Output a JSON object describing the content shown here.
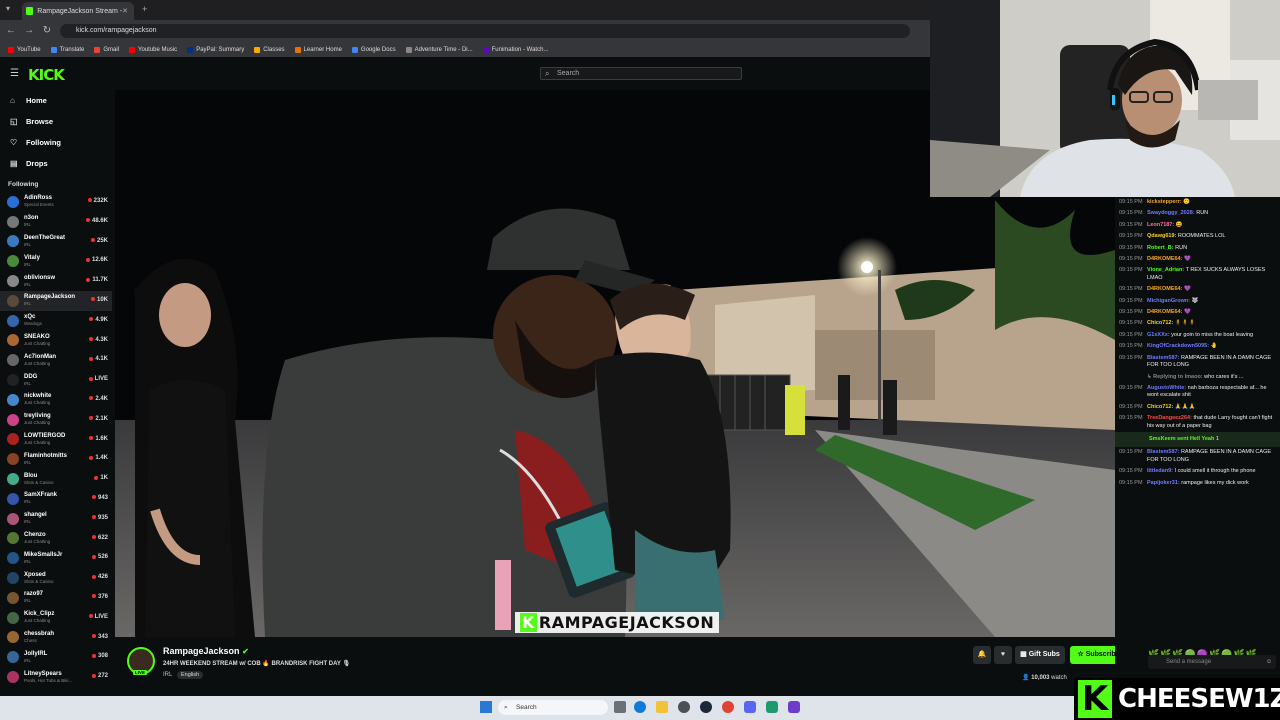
{
  "browser": {
    "tab_title": "RampageJackson Stream - ",
    "url": "kick.com/rampagejackson",
    "bookmarks": [
      {
        "label": "YouTube",
        "color": "#ff0000"
      },
      {
        "label": "Translate",
        "color": "#4285f4"
      },
      {
        "label": "Gmail",
        "color": "#ea4335"
      },
      {
        "label": "Youtube Music",
        "color": "#ff0000"
      },
      {
        "label": "PayPal: Summary",
        "color": "#003087"
      },
      {
        "label": "Classes",
        "color": "#f9ab00"
      },
      {
        "label": "Learner Home",
        "color": "#e8710a"
      },
      {
        "label": "Google Docs",
        "color": "#4285f4"
      },
      {
        "label": "Adventure Time - Di...",
        "color": "#888888"
      },
      {
        "label": "Funimation - Watch...",
        "color": "#5b0bb5"
      }
    ]
  },
  "header": {
    "logo": "KICK",
    "search_placeholder": "Search"
  },
  "nav": [
    {
      "label": "Home",
      "icon": "⌂"
    },
    {
      "label": "Browse",
      "icon": "◱"
    },
    {
      "label": "Following",
      "icon": "♡"
    },
    {
      "label": "Drops",
      "icon": "▤"
    }
  ],
  "following": {
    "heading": "Following",
    "items": [
      {
        "name": "AdinRoss",
        "cat": "Special Events",
        "count": "232K"
      },
      {
        "name": "n3on",
        "cat": "IRL",
        "count": "48.6K"
      },
      {
        "name": "DeenTheGreat",
        "cat": "IRL",
        "count": "25K"
      },
      {
        "name": "Vitaly",
        "cat": "IRL",
        "count": "12.6K"
      },
      {
        "name": "oblivionsw",
        "cat": "IRL",
        "count": "11.7K"
      },
      {
        "name": "RampageJackson",
        "cat": "IRL",
        "count": "10K",
        "active": true
      },
      {
        "name": "xQc",
        "cat": "Wardogs",
        "count": "4.9K"
      },
      {
        "name": "SNEAKO",
        "cat": "Just Chatting",
        "count": "4.3K"
      },
      {
        "name": "Ac7ionMan",
        "cat": "Just Chatting",
        "count": "4.1K"
      },
      {
        "name": "DDG",
        "cat": "IRL",
        "count": "LIVE"
      },
      {
        "name": "nickwhite",
        "cat": "Just Chatting",
        "count": "2.4K"
      },
      {
        "name": "treyliving",
        "cat": "Just Chatting",
        "count": "2.1K"
      },
      {
        "name": "LOWTIERGOD",
        "cat": "Just Chatting",
        "count": "1.6K"
      },
      {
        "name": "Flaminhotmitts",
        "cat": "IRL",
        "count": "1.4K"
      },
      {
        "name": "Blou",
        "cat": "Slots & Casino",
        "count": "1K"
      },
      {
        "name": "SamXFrank",
        "cat": "IRL",
        "count": "943"
      },
      {
        "name": "shangel",
        "cat": "IRL",
        "count": "935"
      },
      {
        "name": "Chenzo",
        "cat": "Just Chatting",
        "count": "622"
      },
      {
        "name": "MikeSmallsJr",
        "cat": "IRL",
        "count": "526"
      },
      {
        "name": "Xposed",
        "cat": "Slots & Casino",
        "count": "426"
      },
      {
        "name": "razo97",
        "cat": "IRL",
        "count": "376"
      },
      {
        "name": "Kick_Clipz",
        "cat": "Just Chatting",
        "count": "LIVE"
      },
      {
        "name": "chessbrah",
        "cat": "Chess",
        "count": "343"
      },
      {
        "name": "JollyIRL",
        "cat": "IRL",
        "count": "308"
      },
      {
        "name": "LitneySpears",
        "cat": "Pools, Hot Tubs & Biki...",
        "count": "272"
      }
    ]
  },
  "stream": {
    "streamer": "RampageJackson",
    "title": "24HR WEEKEND STREAM w/ COB 🔥 BRANDRISK FIGHT DAY 🎙",
    "category": "IRL",
    "language": "English",
    "viewers": "10,003",
    "watch_suffix": "watch",
    "overlay_text": "RAMPAGEJACKSON",
    "live_badge": "LIVE"
  },
  "actions": {
    "gift": "Gift Subs",
    "subscribe": "Subscribe",
    "chat_placeholder": "Send a message"
  },
  "chat": [
    {
      "t": "09:15 PM",
      "u": "kickstepperr:",
      "c": "#f5a623",
      "m": "",
      "e": "🙂"
    },
    {
      "t": "09:15 PM",
      "u": "Swaydoggy_2028:",
      "c": "#6f7cff",
      "m": "RUN"
    },
    {
      "t": "09:15 PM",
      "u": "Leon7187:",
      "c": "#ff6fa8",
      "m": "",
      "e": "😆"
    },
    {
      "t": "09:15 PM",
      "u": "Qdawg619:",
      "c": "#f5d32b",
      "m": "ROOMMATES LOL"
    },
    {
      "t": "09:15 PM",
      "u": "Robert_B:",
      "c": "#53fc18",
      "m": "RUN"
    },
    {
      "t": "09:15 PM",
      "u": "D4RKOME64:",
      "c": "#f5a623",
      "m": "",
      "e": "💜"
    },
    {
      "t": "09:15 PM",
      "u": "Vione_Adrian:",
      "c": "#53fc18",
      "m": "T REX SUCKS ALWAYS LOSES LMAO"
    },
    {
      "t": "09:15 PM",
      "u": "D4RKOME64:",
      "c": "#f5a623",
      "m": "",
      "e": "💜"
    },
    {
      "t": "09:15 PM",
      "u": "MichiganGrown:",
      "c": "#6f7cff",
      "m": "",
      "e": "🐺"
    },
    {
      "t": "09:15 PM",
      "u": "D4RKOME64:",
      "c": "#f5a623",
      "m": "",
      "e": "💜"
    },
    {
      "t": "09:15 PM",
      "u": "Chico712:",
      "c": "#f5d32b",
      "m": "",
      "e": "🧍🧍🧍"
    },
    {
      "t": "09:15 PM",
      "u": "G1sXXx:",
      "c": "#6f7cff",
      "m": "your goin to miss the boat leaving"
    },
    {
      "t": "09:15 PM",
      "u": "KingOfCrackdown5095:",
      "c": "#6f7cff",
      "m": "",
      "e": "🤚"
    },
    {
      "t": "09:15 PM",
      "u": "Blastem587:",
      "c": "#6f7cff",
      "m": "RAMPAGE BEEN IN A DAMN CAGE FOR TOO LONG"
    },
    {
      "t": "",
      "u": "↳ Replying to lmaoo:",
      "c": "#888888",
      "m": "who cares it's ..."
    },
    {
      "t": "09:15 PM",
      "u": "AugustoWhite:",
      "c": "#6f7cff",
      "m": "nah barboza respectable af... he wont escalate shit"
    },
    {
      "t": "09:15 PM",
      "u": "Chico712:",
      "c": "#f5d32b",
      "m": "",
      "e": "🙏🙏🙏"
    },
    {
      "t": "09:15 PM",
      "u": "TreeDangeez264:",
      "c": "#ff4b4b",
      "m": "that dude Larry fought can't fight his way out of a paper bag"
    },
    {
      "t": "",
      "u": "SmsKeem sent Hell Yeah",
      "c": "#53fc18",
      "m": "1",
      "gift": true
    },
    {
      "t": "09:15 PM",
      "u": "Blastem587:",
      "c": "#6f7cff",
      "m": "RAMPAGE BEEN IN A DAMN CAGE FOR TOO LONG"
    },
    {
      "t": "09:15 PM",
      "u": "Iittledan9:",
      "c": "#6f7cff",
      "m": "I could smell it through the phone"
    },
    {
      "t": "09:15 PM",
      "u": "Papijoker31:",
      "c": "#6f7cff",
      "m": "rampage likes my dick work"
    }
  ],
  "taskbar": {
    "search": "Search"
  },
  "brand": {
    "letter": "K",
    "name": "CHEESEW1Z"
  }
}
